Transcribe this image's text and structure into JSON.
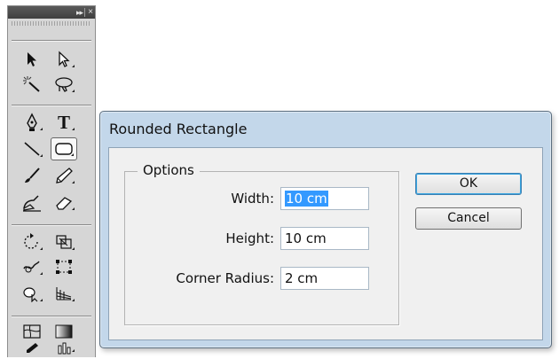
{
  "toolbox": {
    "collapse_glyph": "▸▸",
    "close_glyph": "×",
    "tools": [
      {
        "name": "selection-tool-icon"
      },
      {
        "name": "direct-selection-tool-icon"
      },
      {
        "name": "magic-wand-tool-icon"
      },
      {
        "name": "lasso-tool-icon"
      },
      {
        "name": "pen-tool-icon"
      },
      {
        "name": "type-tool-icon",
        "label": "T"
      },
      {
        "name": "line-segment-tool-icon"
      },
      {
        "name": "rounded-rectangle-tool-icon",
        "active": true
      },
      {
        "name": "paintbrush-tool-icon"
      },
      {
        "name": "pencil-tool-icon"
      },
      {
        "name": "blob-brush-tool-icon"
      },
      {
        "name": "eraser-tool-icon"
      },
      {
        "name": "rotate-tool-icon"
      },
      {
        "name": "scale-tool-icon"
      },
      {
        "name": "warp-tool-icon"
      },
      {
        "name": "free-transform-tool-icon"
      },
      {
        "name": "shape-builder-tool-icon"
      },
      {
        "name": "perspective-grid-tool-icon"
      },
      {
        "name": "mesh-tool-icon"
      },
      {
        "name": "gradient-tool-icon"
      },
      {
        "name": "eyedropper-tool-icon"
      },
      {
        "name": "graph-tool-icon"
      }
    ]
  },
  "dialog": {
    "title": "Rounded Rectangle",
    "options_label": "Options",
    "fields": {
      "width": {
        "label": "Width:",
        "value": "10 cm"
      },
      "height": {
        "label": "Height:",
        "value": "10 cm"
      },
      "corner_radius": {
        "label": "Corner Radius:",
        "value": "2 cm"
      }
    },
    "ok_label": "OK",
    "cancel_label": "Cancel"
  }
}
